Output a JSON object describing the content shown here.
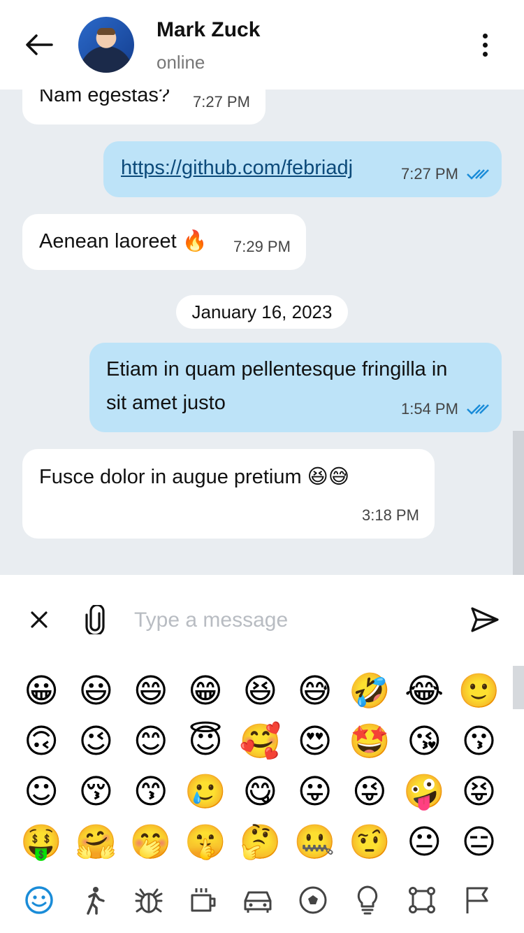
{
  "header": {
    "name": "Mark Zuck",
    "status": "online"
  },
  "messages": [
    {
      "dir": "in",
      "text": "Nam egestas?",
      "time": "7:27 PM"
    },
    {
      "dir": "out",
      "text": "https://github.com/febriadj",
      "time": "7:27 PM",
      "link": true
    },
    {
      "dir": "in",
      "text": "Aenean laoreet 🔥",
      "time": "7:29 PM"
    },
    {
      "dir": "out",
      "text_line1": "Etiam in quam pellentesque fringilla in",
      "text_line2": "sit amet justo",
      "time": "1:54 PM"
    },
    {
      "dir": "in",
      "text": "Fusce dolor in augue pretium 😆😅",
      "time": "3:18 PM"
    }
  ],
  "date_separator": "January 16, 2023",
  "composer": {
    "placeholder": "Type a message"
  },
  "emojis": [
    "😀",
    "😃",
    "😄",
    "😁",
    "😆",
    "😅",
    "🤣",
    "😂",
    "🙂",
    "🙃",
    "😉",
    "😊",
    "😇",
    "🥰",
    "😍",
    "🤩",
    "😘",
    "😗",
    "☺",
    "😚",
    "😙",
    "🥲",
    "😋",
    "😛",
    "😜",
    "🤪",
    "😝",
    "🤑",
    "🤗",
    "🤭",
    "🤫",
    "🤔",
    "🤐",
    "🤨",
    "😐",
    "😑"
  ],
  "emoji_categories": [
    "smileys-icon",
    "people-icon",
    "nature-icon",
    "food-icon",
    "travel-icon",
    "activity-icon",
    "objects-icon",
    "symbols-icon",
    "flags-icon"
  ],
  "colors": {
    "accent": "#1a8cd8",
    "outgoing_bubble": "#bde3f8",
    "chat_background": "#e9edf1"
  }
}
